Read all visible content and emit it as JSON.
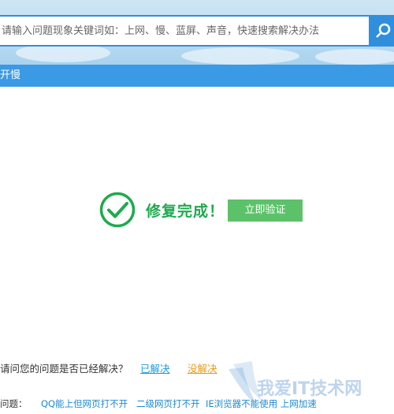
{
  "search": {
    "placeholder": "请输入问题现象关键词如：上网、慢、蓝屏、声音，快速搜索解决办法"
  },
  "title_bar": {
    "text": "开慢"
  },
  "result": {
    "message": "修复完成！",
    "verify_label": "立即验证",
    "success_color": "#1eaa4e"
  },
  "feedback": {
    "question": "请问您的问题是否已经解决？",
    "solved_label": "已解决",
    "unsolved_label": "没解决"
  },
  "related": {
    "label": "问题：",
    "links": [
      "QQ能上但网页打不开",
      "二级网页打不开",
      "IE浏览器不能使用 上网加速"
    ]
  },
  "watermark": {
    "text": "我爱IT技术网"
  },
  "icons": [
    "search-icon",
    "check-circle-icon"
  ],
  "colors": {
    "accent": "#2f8fdc",
    "title_bar": "#3a9ae6",
    "verify_button": "#5cc26a",
    "link": "#1e88d0",
    "unsolved": "#e89a18"
  }
}
